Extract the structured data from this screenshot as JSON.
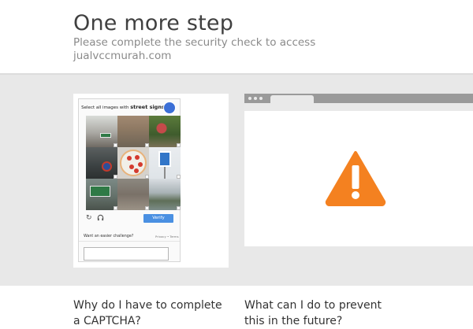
{
  "header": {
    "title": "One more step",
    "subtitle": "Please complete the security check to access jualvccmurah.com"
  },
  "captcha": {
    "prompt_prefix": "Select all images with",
    "prompt_target": "street signs",
    "reload_icon": "reload-icon",
    "audio_icon": "headphones-icon",
    "verify_label": "Verify",
    "easier_label": "Want an easier challenge?",
    "privacy_terms": "Privacy • Terms",
    "answer_value": "",
    "answer_placeholder": ""
  },
  "browser_mock": {
    "icon": "warning-icon",
    "warning_color": "#f48120"
  },
  "footer": {
    "question_left": "Why do I have to complete a CAPTCHA?",
    "question_right": "What can I do to prevent this in the future?"
  },
  "colors": {
    "band": "#e8e8e8",
    "verify": "#4a90e2",
    "warning": "#f48120"
  }
}
